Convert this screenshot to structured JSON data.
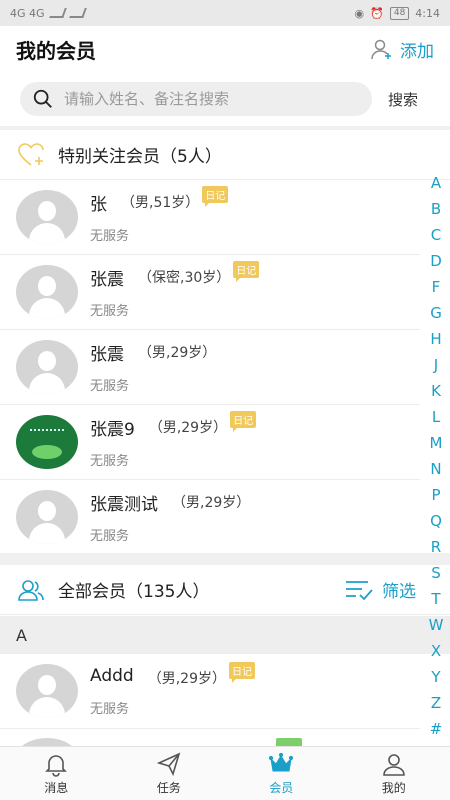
{
  "statusbar": {
    "left": "4G 4G",
    "battery": "48",
    "time": "4:14"
  },
  "header": {
    "title": "我的会员",
    "add_label": "添加"
  },
  "search": {
    "placeholder": "请输入姓名、备注名搜索",
    "button": "搜索"
  },
  "special": {
    "title": "特别关注会员（5人）",
    "items": [
      {
        "name": "张",
        "meta": "（男,51岁）",
        "tag": "日记",
        "sub": "无服务"
      },
      {
        "name": "张震",
        "meta": "（保密,30岁）",
        "tag": "日记",
        "sub": "无服务"
      },
      {
        "name": "张震",
        "meta": "（男,29岁）",
        "tag": "",
        "sub": "无服务"
      },
      {
        "name": "张震9",
        "meta": "（男,29岁）",
        "tag": "日记",
        "sub": "无服务"
      },
      {
        "name": "张震测试",
        "meta": "（男,29岁）",
        "tag": "",
        "sub": "无服务"
      }
    ]
  },
  "all": {
    "title": "全部会员（135人）",
    "filter_label": "筛选",
    "group_letter": "A",
    "items": [
      {
        "name": "Addd",
        "meta": "（男,29岁）",
        "tag": "日记",
        "sub": "无服务"
      }
    ]
  },
  "index_letters": [
    "A",
    "B",
    "C",
    "D",
    "F",
    "G",
    "H",
    "J",
    "K",
    "L",
    "M",
    "N",
    "P",
    "Q",
    "R",
    "S",
    "T",
    "W",
    "X",
    "Y",
    "Z",
    "#"
  ],
  "tabs": [
    {
      "label": "消息",
      "icon": "bell-icon"
    },
    {
      "label": "任务",
      "icon": "paper-plane-icon"
    },
    {
      "label": "会员",
      "icon": "crown-icon",
      "active": true
    },
    {
      "label": "我的",
      "icon": "user-icon"
    }
  ],
  "colors": {
    "accent": "#1aa0c8",
    "tag": "#f1c85a"
  }
}
